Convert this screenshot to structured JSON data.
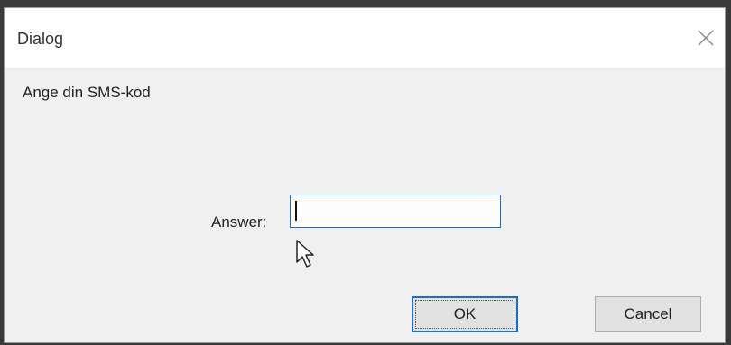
{
  "window": {
    "title": "Dialog",
    "close_icon": "close-icon"
  },
  "prompt": "Ange din SMS-kod",
  "answer": {
    "label": "Answer:",
    "value": "",
    "placeholder": ""
  },
  "buttons": {
    "ok_label": "OK",
    "cancel_label": "Cancel"
  },
  "colors": {
    "focus_accent": "#1a6fc4",
    "background": "#f0f0f0"
  }
}
